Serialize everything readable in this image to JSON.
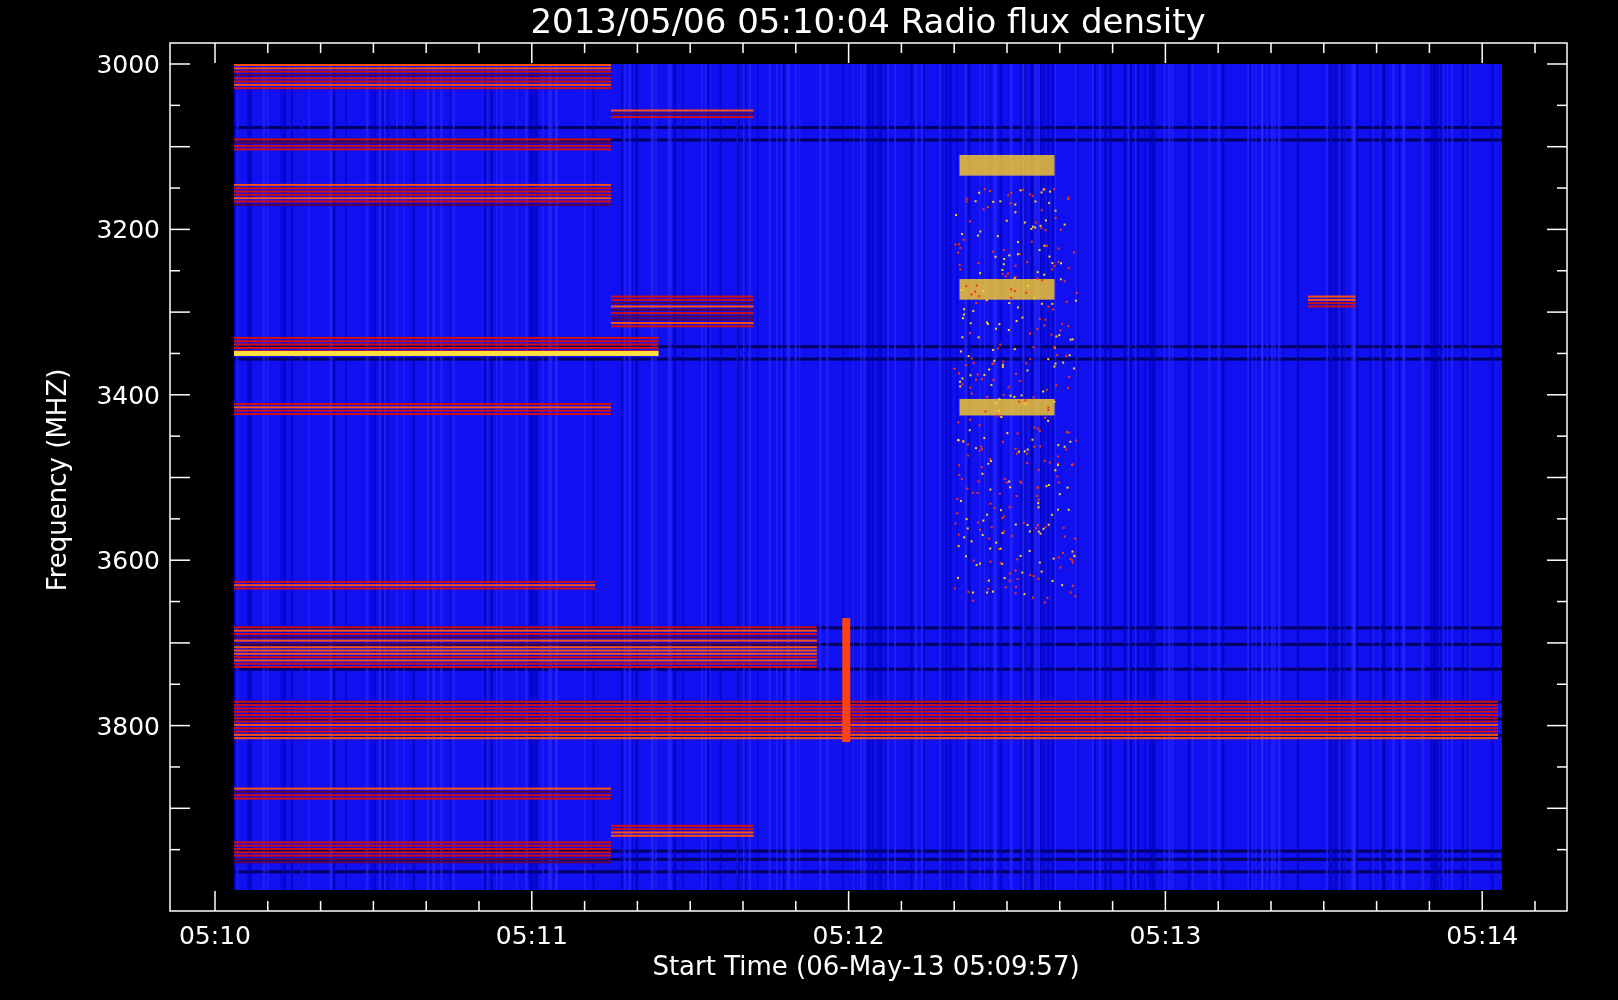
{
  "title": "2013/05/06 05:10:04 Radio flux density",
  "y_axis": {
    "label": "Frequency (MHZ)",
    "ticks": [
      "3000",
      "3200",
      "3400",
      "3600",
      "3800"
    ]
  },
  "x_axis": {
    "label": "Start Time (06-May-13 05:09:57)",
    "ticks": [
      "05:10",
      "05:11",
      "05:12",
      "05:13",
      "05:14"
    ]
  }
}
